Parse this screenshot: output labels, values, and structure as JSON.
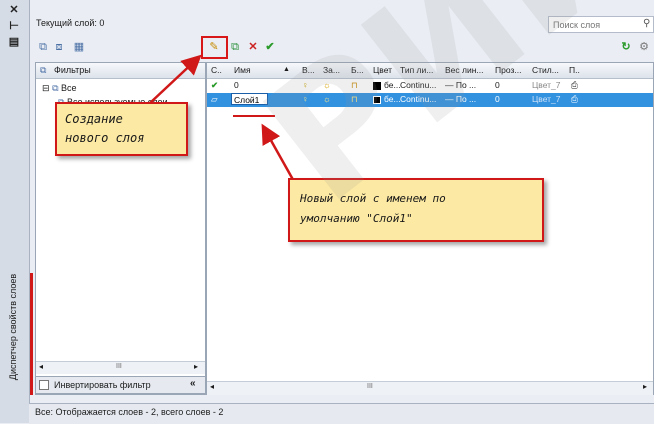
{
  "palette": {
    "vertical_title": "Диспетчер свойств слоев",
    "close_glyph": "✕",
    "pin_glyph": "⊢",
    "props_glyph": "▤"
  },
  "header": {
    "current_layer": "Текущий слой: 0",
    "search_placeholder": "Поиск слоя"
  },
  "filters": {
    "header": "Фильтры",
    "collapse_glyph": "«",
    "tree_all": "Все",
    "tree_used": "Все используемые слои",
    "invert_label": "Инвертировать фильтр",
    "scroll_mark": "III"
  },
  "columns": [
    "С..",
    "Имя",
    "В...",
    "За...",
    "Б...",
    "Цвет",
    "Тип ли...",
    "Вес лин...",
    "Проз...",
    "Стил...",
    "П.."
  ],
  "rows": [
    {
      "status": "✔",
      "name": "0",
      "color_name": "бе...",
      "linetype": "Continu...",
      "lineweight": "— По ...",
      "transparency": "0",
      "plotstyle": "Цвет_7"
    },
    {
      "status": "▱",
      "name": "Слой1",
      "color_name": "бе...",
      "linetype": "Continu...",
      "lineweight": "— По ...",
      "transparency": "0",
      "plotstyle": "Цвет_7"
    }
  ],
  "status_bar": "Все: Отображается слоев - 2, всего слоев - 2",
  "callouts": {
    "create_line1": "Создание",
    "create_line2": "нового слоя",
    "default_line1": "Новый слой с именем по",
    "default_line2": "умолчанию \"Слой1\""
  },
  "watermark": "РИЙ БГ",
  "colors": {
    "accent_red": "#d01818",
    "selection": "#3392e0",
    "callout_bg": "#fce9a3"
  }
}
